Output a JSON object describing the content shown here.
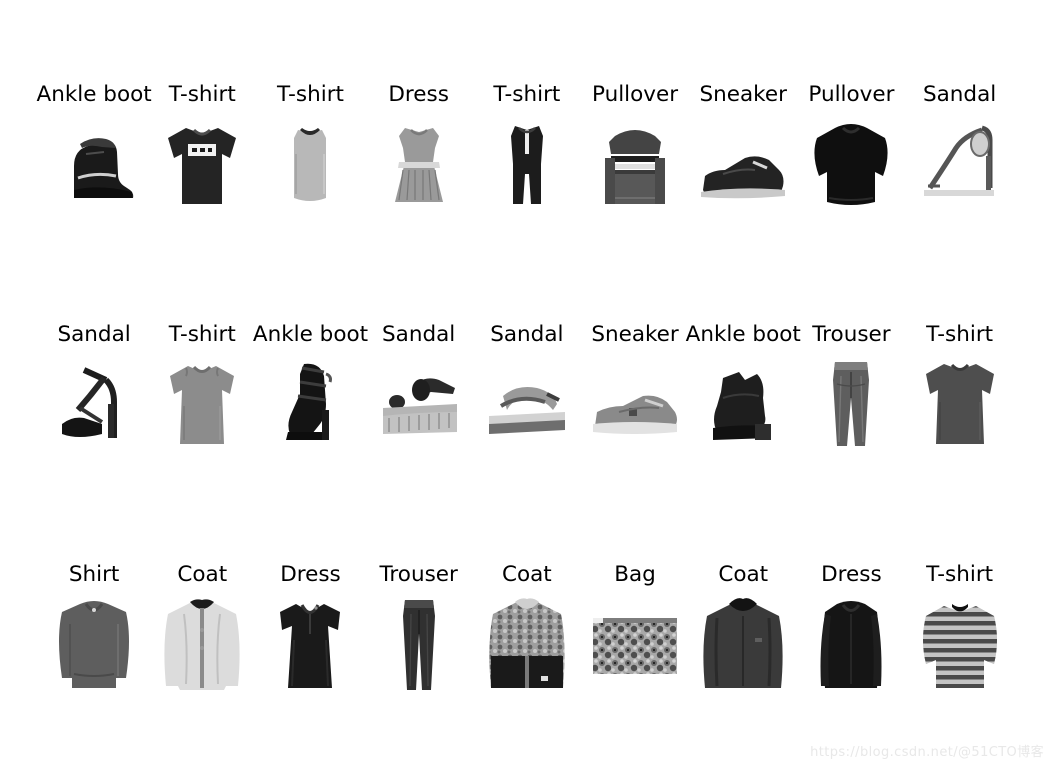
{
  "figure": {
    "background_color": "#ffffff",
    "label_color": "#000000",
    "rows": 3,
    "columns": 9
  },
  "watermark": {
    "text": "https://blog.csdn.net/@51CTO博客",
    "color": "#e8e8e8"
  },
  "samples": [
    [
      {
        "label": "Ankle boot",
        "icon": "ankle-boot-high-top-icon"
      },
      {
        "label": "T-shirt",
        "icon": "tshirt-dark-graphic-icon"
      },
      {
        "label": "T-shirt",
        "icon": "tank-top-light-icon"
      },
      {
        "label": "Dress",
        "icon": "dress-pleated-grey-icon"
      },
      {
        "label": "T-shirt",
        "icon": "romper-dark-icon"
      },
      {
        "label": "Pullover",
        "icon": "pullover-striped-icon"
      },
      {
        "label": "Sneaker",
        "icon": "sneaker-low-dark-icon"
      },
      {
        "label": "Pullover",
        "icon": "pullover-black-icon"
      },
      {
        "label": "Sandal",
        "icon": "sandal-heel-strappy-icon"
      }
    ],
    [
      {
        "label": "Sandal",
        "icon": "sandal-platform-heel-icon"
      },
      {
        "label": "T-shirt",
        "icon": "tshirt-grey-short-sleeve-icon"
      },
      {
        "label": "Ankle boot",
        "icon": "ankle-boot-heel-buckle-icon"
      },
      {
        "label": "Sandal",
        "icon": "sandal-wedge-icon"
      },
      {
        "label": "Sandal",
        "icon": "sandal-flat-strap-icon"
      },
      {
        "label": "Sneaker",
        "icon": "sneaker-grey-low-icon"
      },
      {
        "label": "Ankle boot",
        "icon": "ankle-boot-chelsea-icon"
      },
      {
        "label": "Trouser",
        "icon": "trouser-jeans-icon"
      },
      {
        "label": "T-shirt",
        "icon": "tshirt-dark-grey-icon"
      }
    ],
    [
      {
        "label": "Shirt",
        "icon": "shirt-longsleeve-grey-icon"
      },
      {
        "label": "Coat",
        "icon": "coat-light-hooded-icon"
      },
      {
        "label": "Dress",
        "icon": "dress-dark-short-sleeve-icon"
      },
      {
        "label": "Trouser",
        "icon": "trouser-slim-dark-icon"
      },
      {
        "label": "Coat",
        "icon": "coat-patterned-hooded-icon"
      },
      {
        "label": "Bag",
        "icon": "bag-patterned-clutch-icon"
      },
      {
        "label": "Coat",
        "icon": "coat-dark-hooded-icon"
      },
      {
        "label": "Dress",
        "icon": "dress-black-long-sleeve-icon"
      },
      {
        "label": "T-shirt",
        "icon": "tshirt-striped-icon"
      }
    ]
  ]
}
